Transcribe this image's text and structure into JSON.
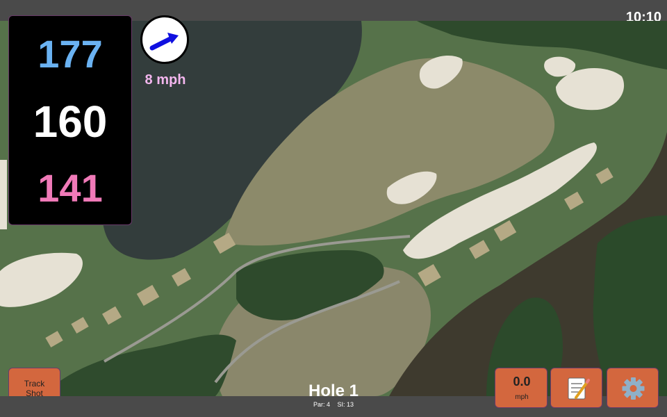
{
  "status": {
    "time": "10:10"
  },
  "distances": {
    "back": "177",
    "middle": "160",
    "front": "141"
  },
  "wind": {
    "speed_label": "8 mph",
    "direction_icon": "arrow-icon"
  },
  "hole": {
    "title": "Hole 1",
    "par": "Par: 4",
    "si": "SI: 13"
  },
  "buttons": {
    "track_line1": "Track",
    "track_line2": "Shot",
    "speed_value": "0.0",
    "speed_unit": "mph",
    "notes_icon": "notepad-icon",
    "settings_icon": "gear-icon"
  },
  "colors": {
    "back": "#6ab2f2",
    "middle": "#ffffff",
    "front": "#f07ab8",
    "wind_text": "#f3b6ee",
    "button": "#d3673e",
    "bar": "#4a4a4a"
  }
}
